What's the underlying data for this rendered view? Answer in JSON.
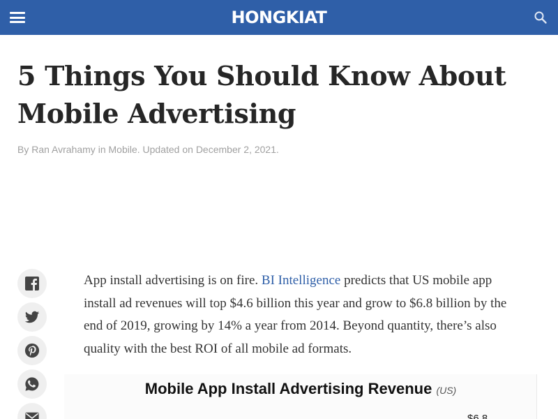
{
  "header": {
    "logo_text": "HONGKIAT",
    "background_color": "#2f5fa8",
    "menu_icon": "hamburger-menu-icon",
    "search_icon": "search-icon"
  },
  "article": {
    "title": "5 Things You Should Know About Mobile Advertising",
    "byline": {
      "by": "By",
      "author": "Ran Avrahamy",
      "in": "in",
      "category": "Mobile",
      "updated_prefix": ". Updated on",
      "date": "December 2, 2021",
      "end": "."
    },
    "intro": {
      "text_before_link": "App install advertising is on fire. ",
      "link_text": "BI Intelligence",
      "text_after_link": " predicts that US mobile app install ad revenues will top $4.6 billion this year and grow to $6.8 billion by the end of 2019, growing by 14% a year from 2014. Beyond quantity, there’s also quality with the best ROI of all mobile ad formats."
    },
    "figure": {
      "title": "Mobile App Install Advertising Revenue",
      "unit": "(US)",
      "visible_value": "$6.8"
    }
  },
  "share_buttons": [
    {
      "icon": "facebook-icon"
    },
    {
      "icon": "twitter-icon"
    },
    {
      "icon": "pinterest-icon"
    },
    {
      "icon": "whatsapp-icon"
    },
    {
      "icon": "email-icon"
    }
  ]
}
